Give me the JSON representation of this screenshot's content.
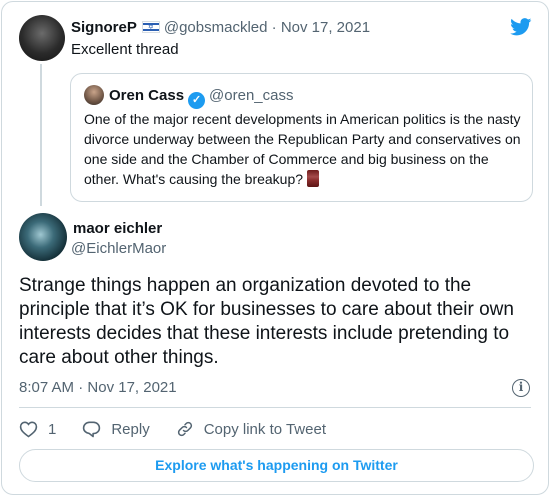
{
  "parent_tweet": {
    "name": "SignoreP",
    "handle": "@gobsmackled",
    "separator": "·",
    "date": "Nov 17, 2021",
    "text": "Excellent thread"
  },
  "quoted_tweet": {
    "name": "Oren Cass",
    "verified": true,
    "handle": "@oren_cass",
    "text": "One of the major recent developments in American politics is the nasty divorce underway between the Republican Party and conservatives on one side and the Chamber of Commerce and big business on the other. What's causing the breakup?"
  },
  "main_tweet": {
    "name": "maor eichler",
    "handle": "@EichlerMaor",
    "text": "Strange things happen an organization devoted to the principle that it’s OK for businesses to care about their own interests decides that these interests include pretending to care about other things.",
    "time": "8:07 AM",
    "separator": "·",
    "date": "Nov 17, 2021"
  },
  "actions": {
    "like_count": "1",
    "reply_label": "Reply",
    "copy_link_label": "Copy link to Tweet"
  },
  "explore_label": "Explore what's happening on Twitter",
  "icons": [
    "twitter-bird-icon",
    "israel-flag-icon",
    "verified-badge-icon",
    "scroll-emoji-icon",
    "info-icon",
    "heart-icon",
    "reply-icon",
    "link-icon"
  ],
  "colors": {
    "accent": "#1d9bf0",
    "text": "#0f1419",
    "muted": "#536471",
    "border": "#cfd9de"
  }
}
